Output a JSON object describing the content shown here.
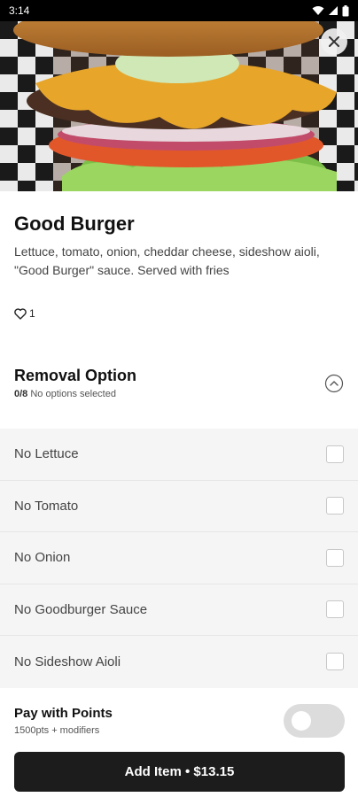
{
  "status_bar": {
    "time": "3:14"
  },
  "item": {
    "title": "Good Burger",
    "description": "Lettuce, tomato, onion, cheddar cheese, sideshow aioli, \"Good Burger\" sauce. Served with fries",
    "like_count": "1"
  },
  "removal": {
    "title": "Removal Option",
    "count": "0/8",
    "status": "No options selected",
    "options": [
      {
        "label": "No Lettuce"
      },
      {
        "label": "No Tomato"
      },
      {
        "label": "No Onion"
      },
      {
        "label": "No Goodburger Sauce"
      },
      {
        "label": "No Sideshow Aioli"
      }
    ]
  },
  "points": {
    "title": "Pay with Points",
    "subtitle": "1500pts + modifiers"
  },
  "add_button": {
    "label": "Add Item • $13.15"
  }
}
